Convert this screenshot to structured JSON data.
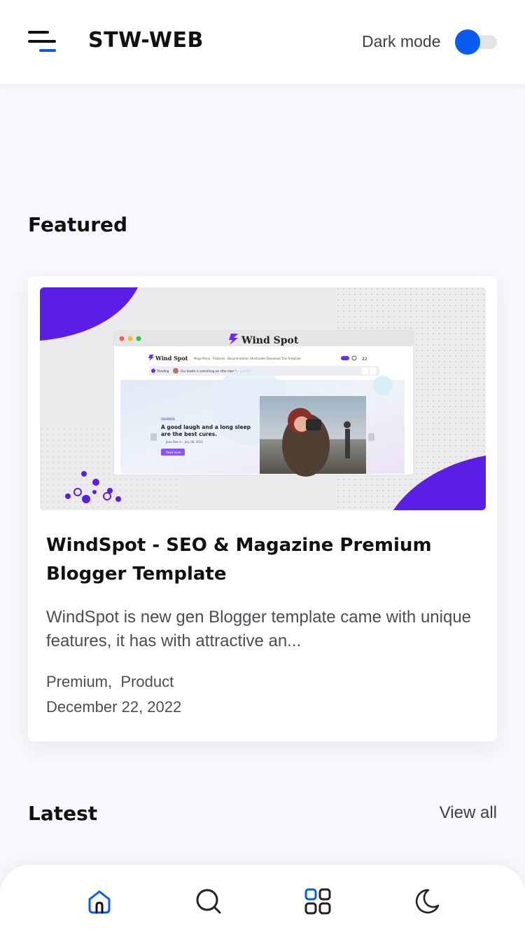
{
  "header": {
    "brand": "STW-WEB",
    "dark_mode_label": "Dark mode",
    "accent_color": "#0a5cf0"
  },
  "featured": {
    "section_title": "Featured",
    "post": {
      "title": "WindSpot - SEO & Magazine Premium Blogger Template",
      "excerpt": "WindSpot is new gen Blogger template came with unique features, it has with attractive an...",
      "tags": [
        "Premium",
        "Product"
      ],
      "date": "December 22, 2022",
      "thumbnail": {
        "logo_text": "Wind Spot",
        "nav_items": [
          "Mega Menu",
          "Features",
          "Documentation",
          "Shortcodes",
          "Download This Template"
        ],
        "trending_label": "Trending",
        "trending_text": "Our health is something we often take for granted.",
        "slide_tag": "Something",
        "slide_title": "A good laugh and a long sleep are the best cures.",
        "slide_meta": "Jane Doe in · July 08, 2022",
        "slide_button": "Read more",
        "date_day": "22",
        "date_month": "Dec 2022"
      }
    }
  },
  "latest": {
    "section_title": "Latest",
    "view_all": "View all"
  },
  "bottom_nav": {
    "items": [
      "home-icon",
      "search-icon",
      "grid-icon",
      "moon-icon"
    ]
  }
}
